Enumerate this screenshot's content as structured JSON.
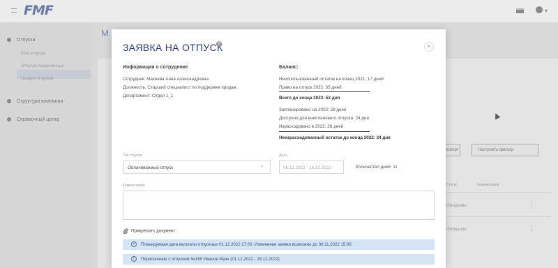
{
  "app": {
    "logo": "FMF"
  },
  "sidebar": {
    "items": [
      {
        "label": "Отпуска"
      },
      {
        "label": "Структура компании"
      },
      {
        "label": "Справочный центр"
      }
    ],
    "sub_items": [
      {
        "label": "Мои отпуска"
      },
      {
        "label": "Отпуска подчиненных"
      },
      {
        "label": "График отпусков"
      }
    ]
  },
  "background": {
    "buttons": [
      "Экспорт",
      "Настроить фильтр"
    ],
    "columns": [
      "Статус",
      "Комментарий"
    ],
    "cells": [
      "Ожидание",
      "Ожидание"
    ]
  },
  "modal": {
    "title": "ЗАЯВКА НА ОТПУСК",
    "employee": {
      "heading": "Информация о сотруднике",
      "name": "Сотрудник: Макеева Анна Александровна",
      "position": "Должность: Старший специалист по поддержке продаж",
      "department": "Департамент: Отдел 1_1"
    },
    "balance": {
      "heading": "Баланс:",
      "unused_2021": "Неиспользованный остаток на конец 2021: 17 дней",
      "right_2022": "Право на отпуск 2022: 35 дней",
      "total": "Всего до конца 2022: 52 дня",
      "planned": "Запланировано на 2022: 28 дней",
      "available": "Доступно для внепланового отпуска: 24 дня",
      "spent": "Израсходовано в 2022: 28 дней",
      "remaining": "Неизрасходованный остаток до конца 2022: 24 дня"
    },
    "form": {
      "type_label": "Тип отпуска",
      "type_value": "Оплачиваемый отпуск",
      "dates_label": "Даты",
      "dates_value": "06.12.2022 - 16.12.2022",
      "days_count": "Количество дней: 11",
      "comment_label": "Комментарий",
      "comment_value": "",
      "attach_label": "Прикрепить документ"
    },
    "alerts": [
      {
        "text": "Планируемая дата выплаты отпускных 01.12.2022 17:00. Изменение заявки возможно до 30.11.2022 15:00."
      },
      {
        "text": "Пересечение с отпуском №169 Иванов Иван (01.12.2022 - 28.12.2022)"
      }
    ]
  },
  "colors": {
    "accent": "#2c3a75",
    "alert_bg": "#d4e4f4",
    "overlay": "#d9d9d9"
  }
}
